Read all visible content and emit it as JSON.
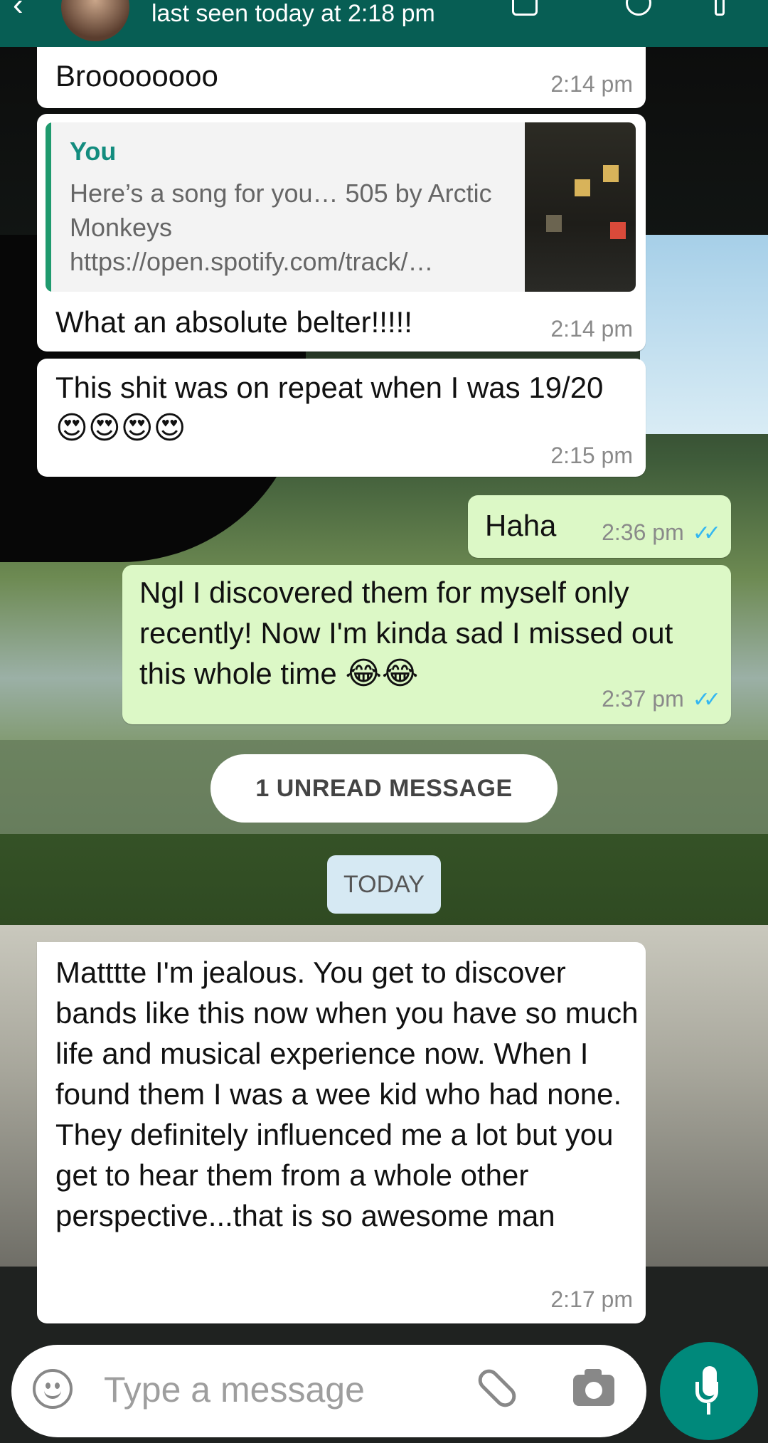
{
  "header": {
    "status": "last seen today at 2:18 pm",
    "back_icon": "arrow-back-icon"
  },
  "messages": [
    {
      "type": "incoming",
      "text": "Broooooooo",
      "time": "2:14 pm"
    },
    {
      "type": "incoming-reply",
      "quoted_author": "You",
      "quoted_text": "Here’s a song for you… 505 by Arctic Monkeys https://open.spotify.com/track/…",
      "text": "What an absolute belter!!!!!",
      "time": "2:14 pm"
    },
    {
      "type": "incoming",
      "text": "This shit was on repeat when I was 19/20",
      "emoji": "😍😍😍😍",
      "time": "2:15 pm"
    },
    {
      "type": "outgoing",
      "text": "Haha",
      "time": "2:36 pm",
      "read": true
    },
    {
      "type": "outgoing",
      "text": "Ngl I discovered them for myself only recently! Now I'm kinda sad I missed out this whole time",
      "emoji": "😂😂",
      "time": "2:37 pm",
      "read": true
    },
    {
      "type": "incoming",
      "text": "Matttte I'm jealous. You get to discover bands like this now when you have so much life and musical experience now. When I found them I was a wee kid who had none.  They definitely influenced me a lot but you get to hear them from a whole other perspective...that is so awesome man",
      "time": "2:17 pm"
    }
  ],
  "unread_banner": "1 UNREAD MESSAGE",
  "date_divider": "TODAY",
  "input": {
    "placeholder": "Type a message",
    "icons": [
      "emoji-icon",
      "attach-icon",
      "camera-icon",
      "mic-icon"
    ]
  },
  "colors": {
    "header": "#075e54",
    "outgoing_bubble": "#dcf8c6",
    "incoming_bubble": "#ffffff",
    "accent": "#00897b",
    "read_ticks": "#34b7f1"
  }
}
